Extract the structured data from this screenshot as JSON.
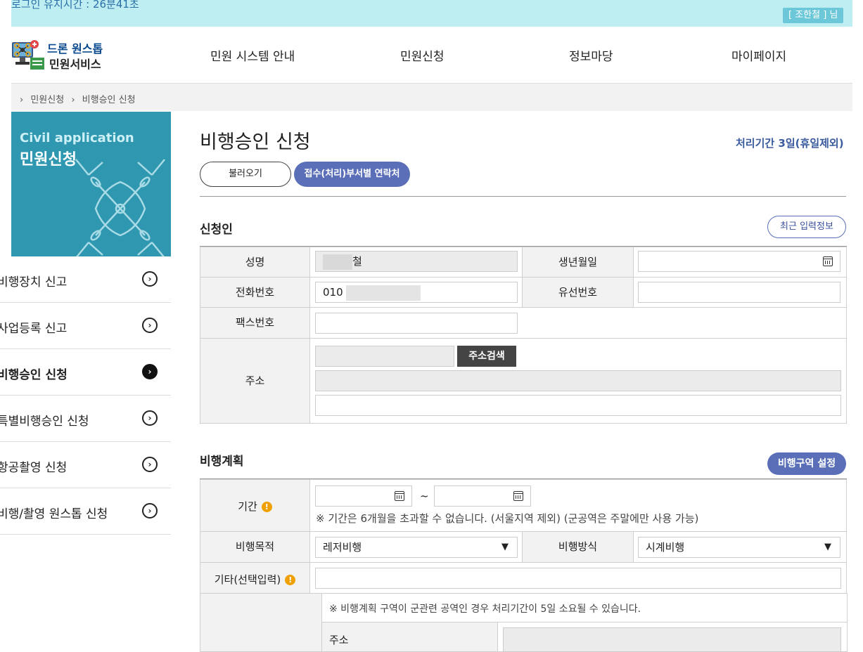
{
  "topbar": {
    "session_text": "로그인 유지시간 : 26분41초",
    "user_name": "[ 조한철 ] 님"
  },
  "logo": {
    "line1": "드론 원스톱",
    "line2": "민원서비스"
  },
  "gnb": [
    "민원 시스템 안내",
    "민원신청",
    "정보마당",
    "마이페이지"
  ],
  "breadcrumb": [
    "›",
    "민원신청",
    "›",
    "비행승인 신청"
  ],
  "sidebar": {
    "hero_en": "Civil application",
    "hero_ko": "민원신청",
    "items": [
      {
        "label": "비행장치 신고",
        "active": false
      },
      {
        "label": "사업등록 신고",
        "active": false
      },
      {
        "label": "비행승인 신청",
        "active": true
      },
      {
        "label": "특별비행승인 신청",
        "active": false
      },
      {
        "label": "항공촬영 신청",
        "active": false
      },
      {
        "label": "비행/촬영 원스톱 신청",
        "active": false
      }
    ]
  },
  "main": {
    "title": "비행승인 신청",
    "period": "처리기간 3일(휴일제외)",
    "load_button": "불러오기",
    "contact_button": "접수(처리)부서별 연락처"
  },
  "applicant": {
    "section_title": "신청인",
    "recent_button": "최근 입력정보",
    "name_label": "성명",
    "name_value": "철",
    "birth_label": "생년월일",
    "phone_label": "전화번호",
    "phone_value": "010",
    "landline_label": "유선번호",
    "fax_label": "팩스번호",
    "address_label": "주소",
    "address_search_button": "주소검색"
  },
  "plan": {
    "section_title": "비행계획",
    "area_button": "비행구역 설정",
    "period_label": "기간",
    "tilde": "~",
    "period_note": "※ 기간은 6개월을 초과할 수 없습니다. (서울지역 제외) (군공역은 주말에만 사용 가능)",
    "purpose_label": "비행목적",
    "purpose_value": "레저비행",
    "method_label": "비행방식",
    "method_value": "시계비행",
    "etc_label": "기타(선택입력)",
    "area_note": "※ 비행계획 구역이 군관련 공역인 경우 처리기간이 5일 소요될 수 있습니다.",
    "area_address_label": "주소"
  },
  "icons": {
    "warn": "!",
    "dropdown": "▼",
    "arrow": "›"
  }
}
